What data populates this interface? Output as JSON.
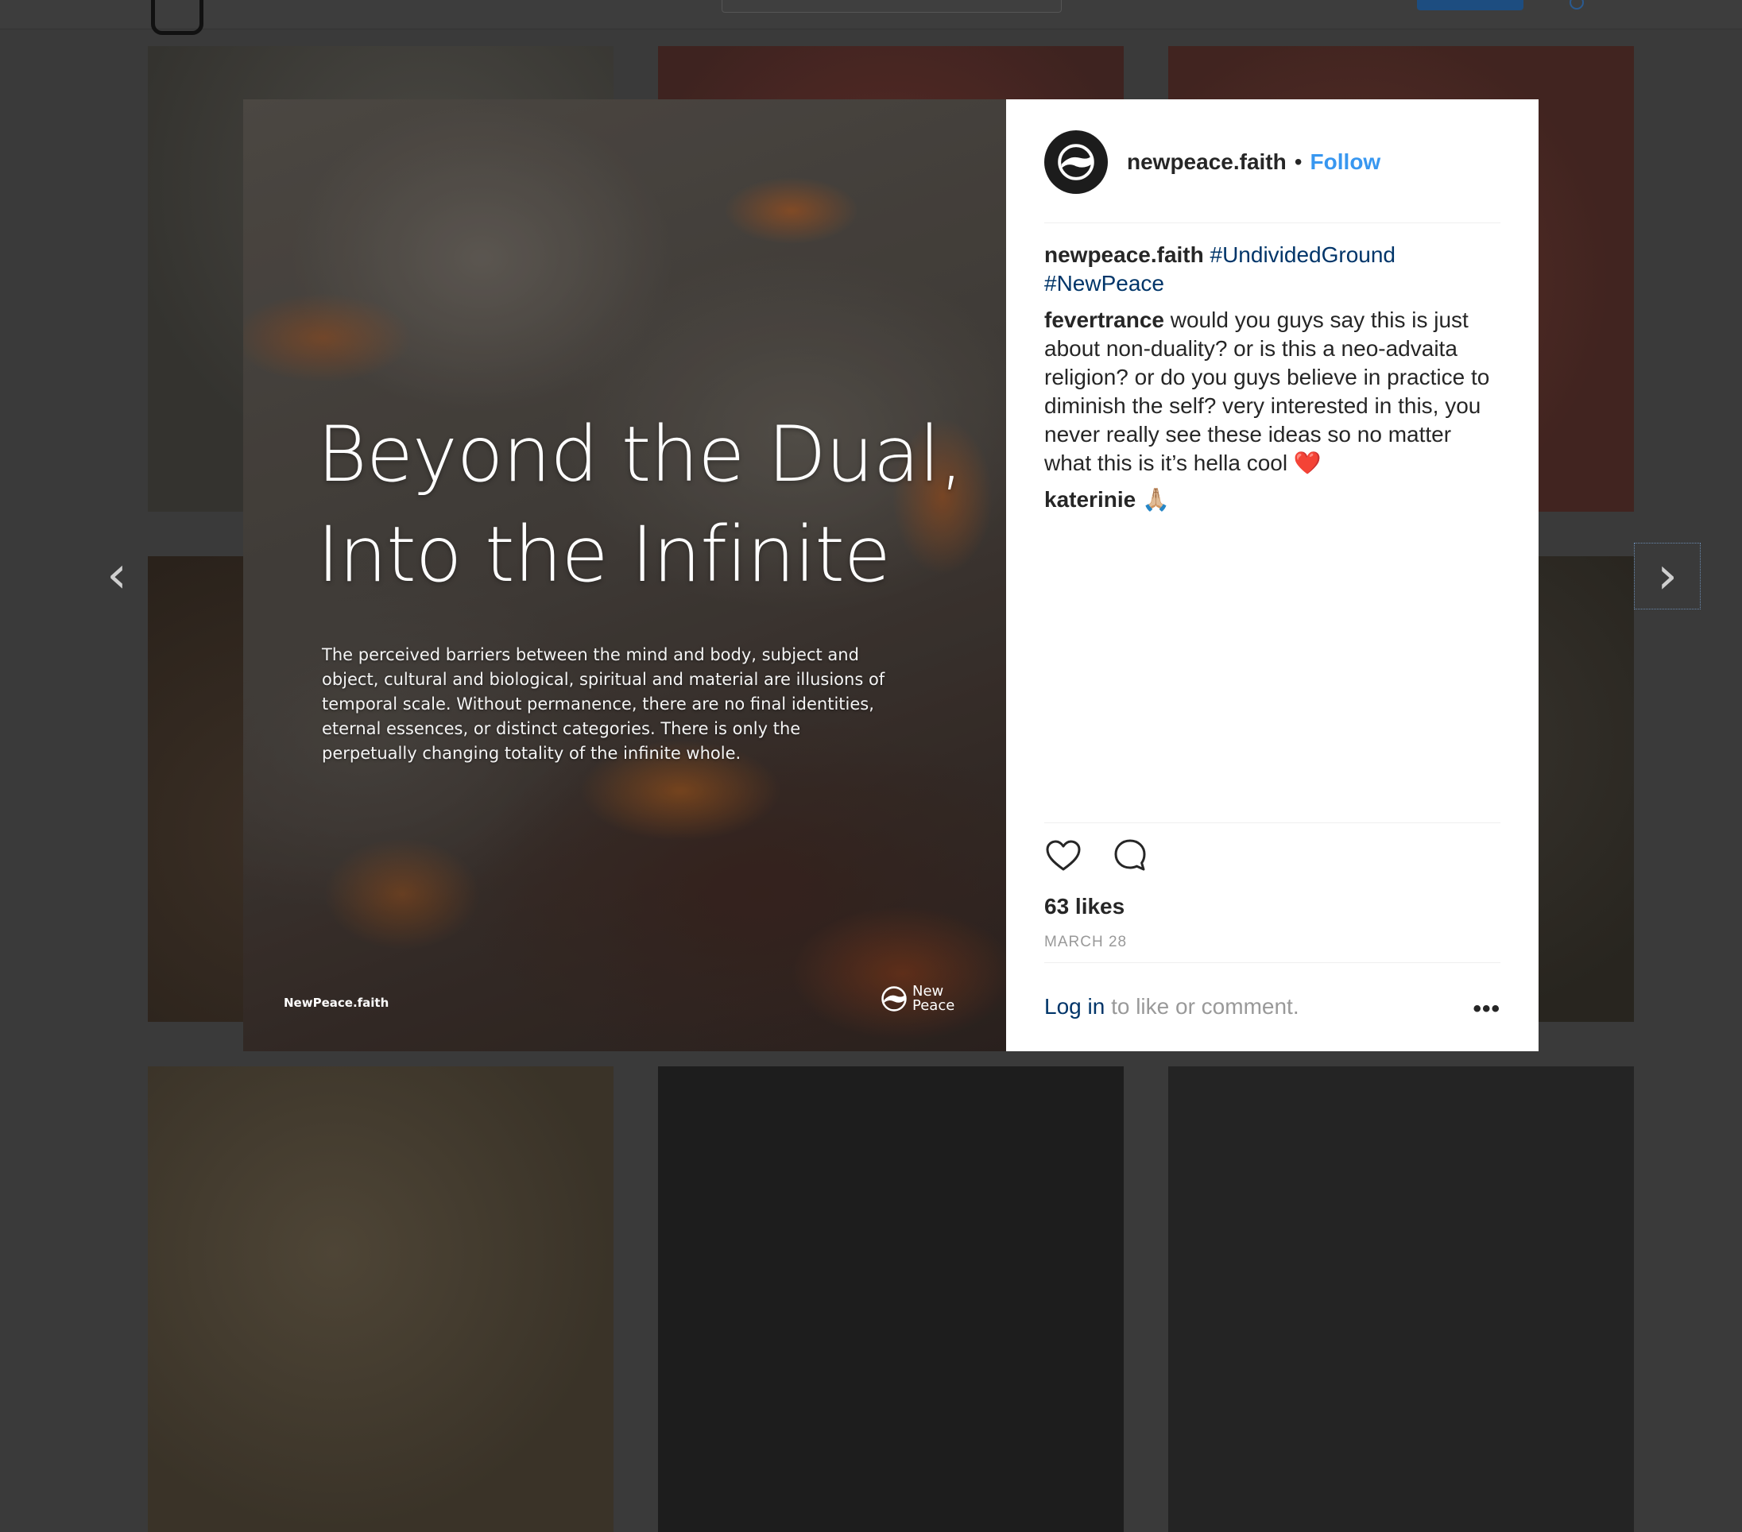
{
  "post": {
    "image": {
      "headline_line1": "Beyond the Dual,",
      "headline_line2": "Into the Infinite",
      "body": "The perceived barriers between the mind and body, subject and object, cultural and biological, spiritual and material are illusions of temporal scale. Without permanence, there are no final identities, eternal essences, or distinct categories. There is only the perpetually changing totality of the infinite whole.",
      "site_mark": "NewPeace.faith",
      "brand_line1": "New",
      "brand_line2": "Peace"
    },
    "header": {
      "username": "newpeace.faith",
      "separator": "•",
      "follow_label": "Follow"
    },
    "caption": {
      "author": "newpeace.faith",
      "tag1": "#UndividedGround",
      "tag2": "#NewPeace"
    },
    "comments": [
      {
        "author": "fevertrance",
        "text": "would you guys say this is just about non-duality? or is this a neo-advaita religion? or do you guys believe in practice to diminish the self? very interested in this, you never really see these ideas so no matter what this is it’s hella cool",
        "emoji": "❤️"
      },
      {
        "author": "katerinie",
        "text": "",
        "emoji": "🙏🏼"
      }
    ],
    "likes": "63 likes",
    "date": "MARCH 28",
    "login_prompt": {
      "link": "Log in",
      "rest": " to like or comment."
    },
    "more_label": "•••"
  },
  "nav": {
    "prev": "‹",
    "next": "›"
  },
  "colors": {
    "link_blue": "#3897f0",
    "tag_navy": "#003569",
    "overlay_bg": "#3a3a3a"
  },
  "icons": [
    "heart-icon",
    "comment-icon",
    "brand-logo-icon",
    "chevron-left-icon",
    "chevron-right-icon"
  ]
}
